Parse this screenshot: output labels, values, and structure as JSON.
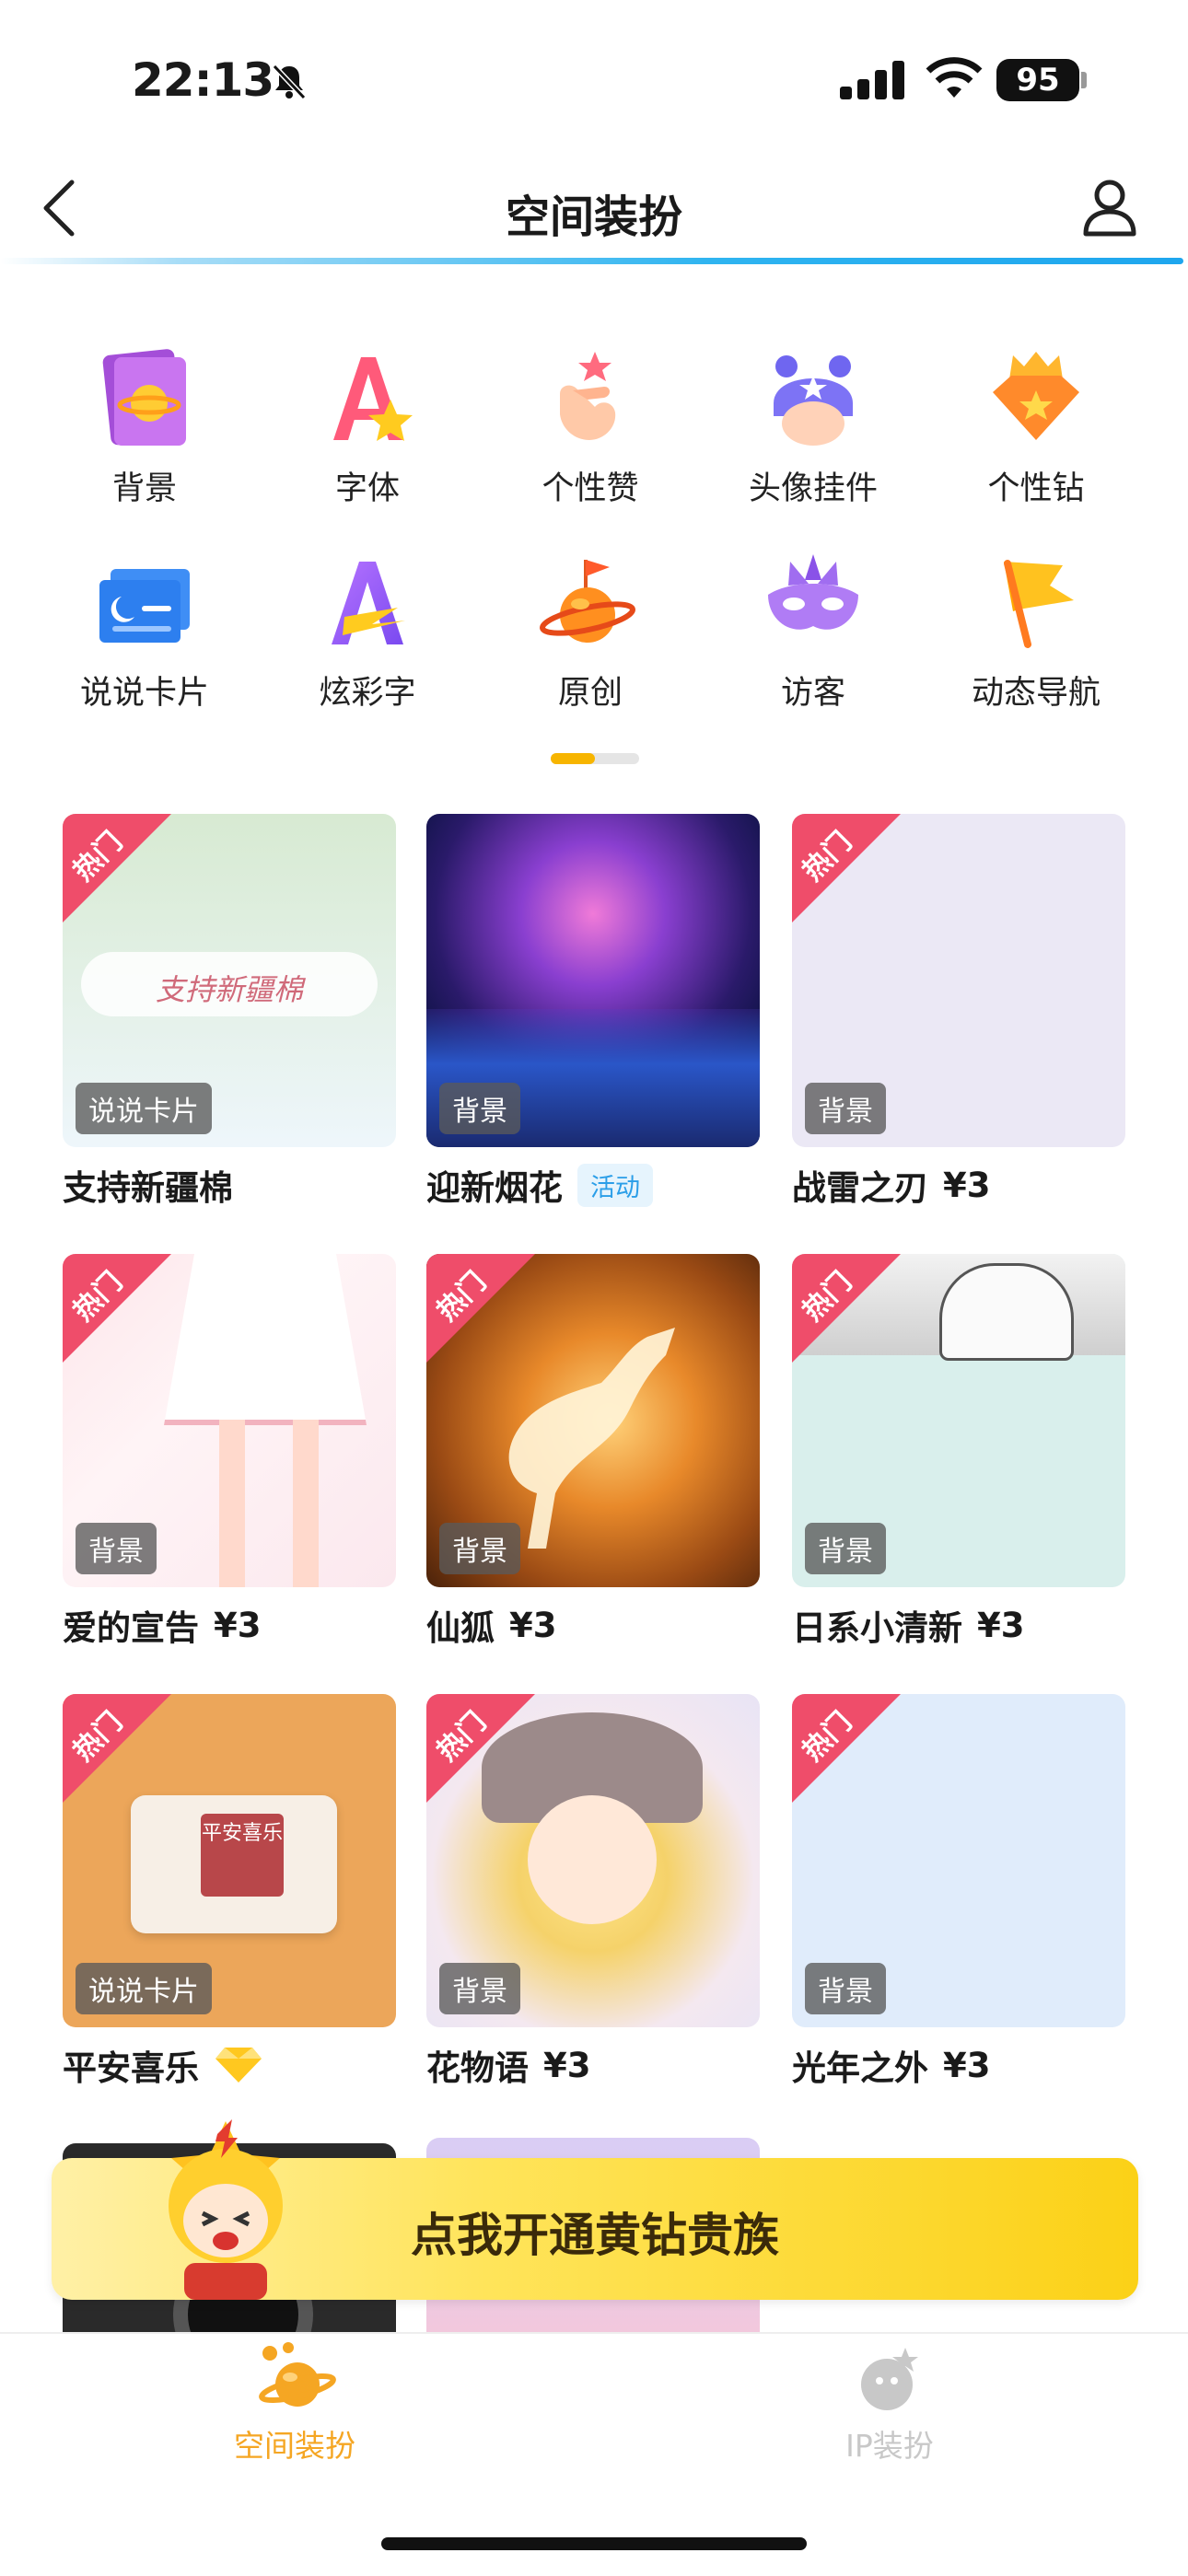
{
  "status": {
    "time": "22:13",
    "battery": "95"
  },
  "header": {
    "title": "空间装扮"
  },
  "categories": [
    {
      "label": "背景",
      "icon": "background-planet-icon"
    },
    {
      "label": "字体",
      "icon": "font-icon"
    },
    {
      "label": "个性赞",
      "icon": "like-hand-icon"
    },
    {
      "label": "头像挂件",
      "icon": "avatar-pendant-icon"
    },
    {
      "label": "个性钻",
      "icon": "diamond-icon"
    },
    {
      "label": "说说卡片",
      "icon": "moon-card-icon"
    },
    {
      "label": "炫彩字",
      "icon": "colorful-text-icon"
    },
    {
      "label": "原创",
      "icon": "original-planet-icon"
    },
    {
      "label": "访客",
      "icon": "mask-icon"
    },
    {
      "label": "动态导航",
      "icon": "flag-icon"
    }
  ],
  "hot_label": "热门",
  "items": [
    {
      "name": "支持新疆棉",
      "tag": "说说卡片",
      "price": "",
      "hot": true,
      "badge": "",
      "card_text": "支持新疆棉"
    },
    {
      "name": "迎新烟花",
      "tag": "背景",
      "price": "",
      "hot": false,
      "badge": "活动"
    },
    {
      "name": "战雷之刃",
      "tag": "背景",
      "price": "¥3",
      "hot": true,
      "badge": ""
    },
    {
      "name": "爱的宣告",
      "tag": "背景",
      "price": "¥3",
      "hot": true,
      "badge": ""
    },
    {
      "name": "仙狐",
      "tag": "背景",
      "price": "¥3",
      "hot": true,
      "badge": ""
    },
    {
      "name": "日系小清新",
      "tag": "背景",
      "price": "¥3",
      "hot": true,
      "badge": ""
    },
    {
      "name": "平安喜乐",
      "tag": "说说卡片",
      "price": "",
      "hot": true,
      "badge": "diamond-icon",
      "card_text": "平安喜乐"
    },
    {
      "name": "花物语",
      "tag": "背景",
      "price": "¥3",
      "hot": true,
      "badge": ""
    },
    {
      "name": "光年之外",
      "tag": "背景",
      "price": "¥3",
      "hot": true,
      "badge": ""
    }
  ],
  "banner": {
    "text": "点我开通黄钻贵族"
  },
  "tabs": [
    {
      "label": "空间装扮",
      "active": true,
      "color": "#f5a623"
    },
    {
      "label": "IP装扮",
      "active": false,
      "color": "#c8c8c8"
    }
  ]
}
